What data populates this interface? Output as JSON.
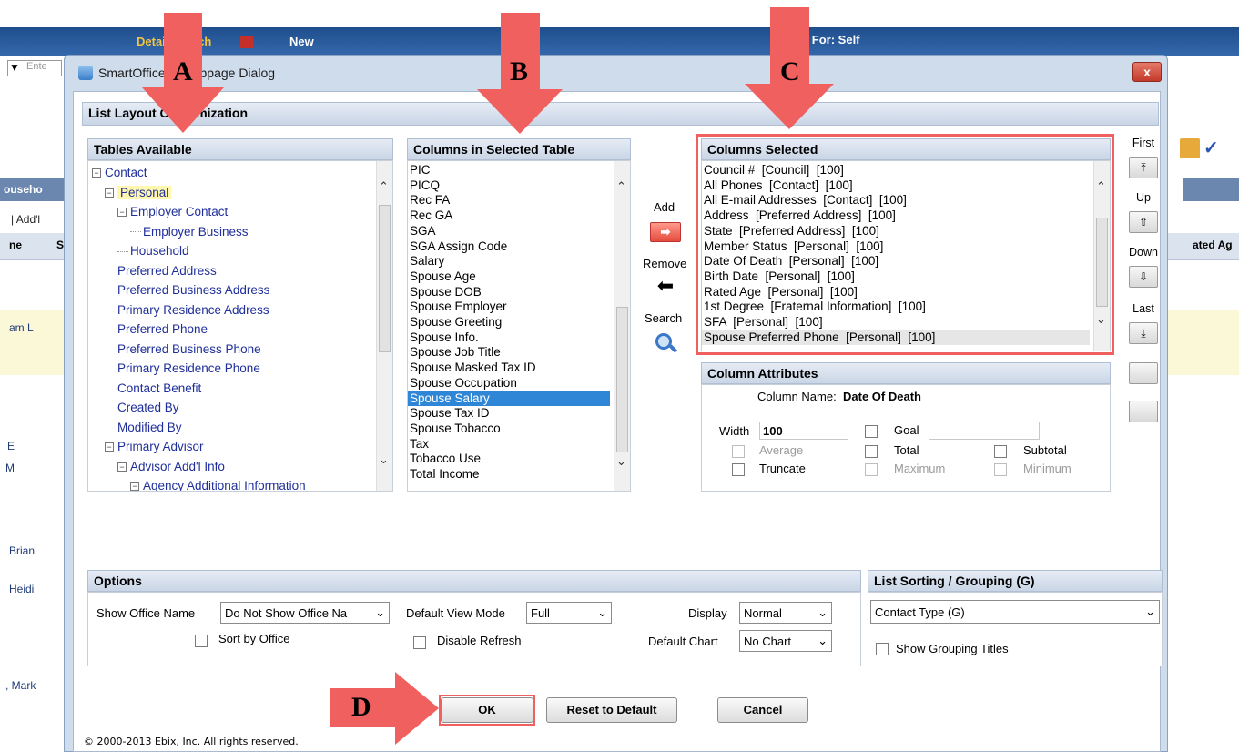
{
  "background": {
    "tabs": [
      "Detail Search",
      "New"
    ],
    "data_for": "Data For: Self",
    "search_placeholder": "Ente",
    "left_header": "ouseho",
    "left_addl": "| Add'l",
    "col_ne": "ne",
    "col_s": "S",
    "right_col": "ated Ag",
    "row_names": [
      "am L",
      "E",
      "M",
      "Brian",
      "Heidi",
      ", Mark"
    ]
  },
  "dialog": {
    "title": "SmartOffice -- Webpage Dialog",
    "close": "x",
    "heading": "List Layout Customization",
    "copyright": "© 2000-2013 Ebix, Inc. All rights reserved."
  },
  "tables_available": {
    "header": "Tables Available",
    "items": [
      {
        "label": "Contact",
        "level": 0,
        "toggle": true
      },
      {
        "label": "Personal",
        "level": 1,
        "toggle": true,
        "highlight": true
      },
      {
        "label": "Employer Contact",
        "level": 2,
        "toggle": true
      },
      {
        "label": "Employer Business",
        "level": 3,
        "toggle": false
      },
      {
        "label": "Household",
        "level": 2,
        "toggle": false
      },
      {
        "label": "Preferred Address",
        "level": 1,
        "toggle": false
      },
      {
        "label": "Preferred Business Address",
        "level": 1,
        "toggle": false
      },
      {
        "label": "Primary Residence Address",
        "level": 1,
        "toggle": false
      },
      {
        "label": "Preferred Phone",
        "level": 1,
        "toggle": false
      },
      {
        "label": "Preferred Business Phone",
        "level": 1,
        "toggle": false
      },
      {
        "label": "Primary Residence Phone",
        "level": 1,
        "toggle": false
      },
      {
        "label": "Contact Benefit",
        "level": 1,
        "toggle": false
      },
      {
        "label": "Created By",
        "level": 1,
        "toggle": false
      },
      {
        "label": "Modified By",
        "level": 1,
        "toggle": false
      },
      {
        "label": "Primary Advisor",
        "level": 1,
        "toggle": true
      },
      {
        "label": "Advisor Add'l Info",
        "level": 2,
        "toggle": true
      },
      {
        "label": "Agency Additional Information",
        "level": 3,
        "toggle": true
      }
    ]
  },
  "columns_in_table": {
    "header": "Columns in Selected Table",
    "items": [
      "PIC",
      "PICQ",
      "Rec FA",
      "Rec GA",
      "SGA",
      "SGA Assign Code",
      "Salary",
      "Spouse Age",
      "Spouse DOB",
      "Spouse Employer",
      "Spouse Greeting",
      "Spouse Info.",
      "Spouse Job Title",
      "Spouse Masked Tax ID",
      "Spouse Occupation",
      "Spouse Salary",
      "Spouse Tax ID",
      "Spouse Tobacco",
      "Tax",
      "Tobacco Use",
      "Total Income"
    ],
    "selected": "Spouse Salary"
  },
  "actions": {
    "add": "Add",
    "remove": "Remove",
    "search": "Search"
  },
  "columns_selected": {
    "header": "Columns Selected",
    "items": [
      "Council #  [Council]  [100]",
      "All Phones  [Contact]  [100]",
      "All E-mail Addresses  [Contact]  [100]",
      "Address  [Preferred Address]  [100]",
      "State  [Preferred Address]  [100]",
      "Member Status  [Personal]  [100]",
      "Date Of Death  [Personal]  [100]",
      "Birth Date  [Personal]  [100]",
      "Rated Age  [Personal]  [100]",
      "1st Degree  [Fraternal Information]  [100]",
      "SFA  [Personal]  [100]",
      "Spouse Preferred Phone  [Personal]  [100]"
    ]
  },
  "order_buttons": {
    "first": "First",
    "up": "Up",
    "down": "Down",
    "last": "Last"
  },
  "attributes": {
    "header": "Column Attributes",
    "column_name_label": "Column Name:",
    "column_name_value": "Date Of Death",
    "width_label": "Width",
    "width_value": "100",
    "goal": "Goal",
    "average": "Average",
    "total": "Total",
    "subtotal": "Subtotal",
    "truncate": "Truncate",
    "maximum": "Maximum",
    "minimum": "Minimum"
  },
  "options": {
    "header": "Options",
    "show_office_label": "Show Office Name",
    "show_office_value": "Do Not Show Office Na",
    "default_view_label": "Default View Mode",
    "default_view_value": "Full",
    "display_label": "Display",
    "display_value": "Normal",
    "sort_by_office": "Sort by Office",
    "disable_refresh": "Disable Refresh",
    "default_chart_label": "Default Chart",
    "default_chart_value": "No Chart"
  },
  "sorting": {
    "header": "List Sorting / Grouping (G)",
    "value": "Contact Type  (G)",
    "show_titles": "Show Grouping Titles"
  },
  "buttons": {
    "ok": "OK",
    "reset": "Reset to Default",
    "cancel": "Cancel"
  },
  "markers": {
    "a": "A",
    "b": "B",
    "c": "C",
    "d": "D"
  },
  "colors": {
    "annotation": "#f0605e",
    "selection": "#2f86d6",
    "header_bg": "#d3deec"
  }
}
